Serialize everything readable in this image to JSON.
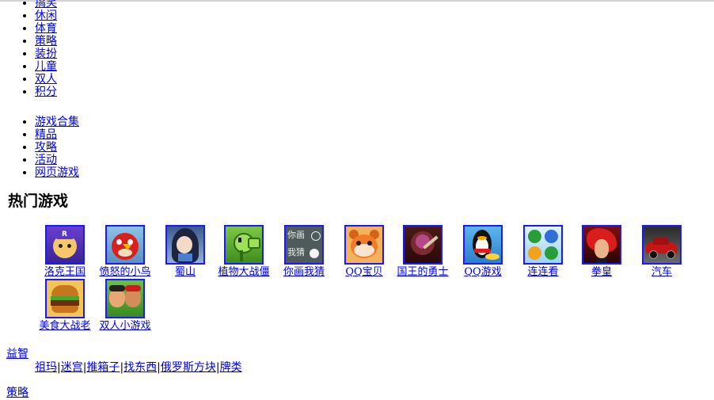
{
  "categories": [
    "搞笑",
    "休闲",
    "体育",
    "策略",
    "装扮",
    "儿童",
    "双人",
    "积分"
  ],
  "site_links": [
    "游戏合集",
    "精品",
    "攻略",
    "活动",
    "网页游戏"
  ],
  "hot_title": "热门游戏",
  "games": [
    {
      "name": "洛克王国",
      "icon": "roco-icon"
    },
    {
      "name": "愤怒的小鸟",
      "icon": "angry-bird-icon"
    },
    {
      "name": "蜀山",
      "icon": "shushan-icon"
    },
    {
      "name": "植物大战僵",
      "icon": "peashooter-icon"
    },
    {
      "name": "你画我猜",
      "icon": "draw-guess-icon"
    },
    {
      "name": "QQ宝贝",
      "icon": "qq-baby-icon"
    },
    {
      "name": "国王的勇士",
      "icon": "king-warrior-icon"
    },
    {
      "name": "QQ游戏",
      "icon": "qq-penguin-icon"
    },
    {
      "name": "连连看",
      "icon": "link-balls-icon"
    },
    {
      "name": "拳皇",
      "icon": "kof-icon"
    },
    {
      "name": "汽车",
      "icon": "car-icon"
    },
    {
      "name": "美食大战老",
      "icon": "burger-icon"
    },
    {
      "name": "双人小游戏",
      "icon": "two-player-icon"
    }
  ],
  "puzzle_section": {
    "title": "益智",
    "links": [
      "祖玛",
      "迷宫",
      "推箱子",
      "找东西",
      "俄罗斯方块",
      "牌类"
    ]
  },
  "strategy_section": {
    "title": "策略"
  }
}
